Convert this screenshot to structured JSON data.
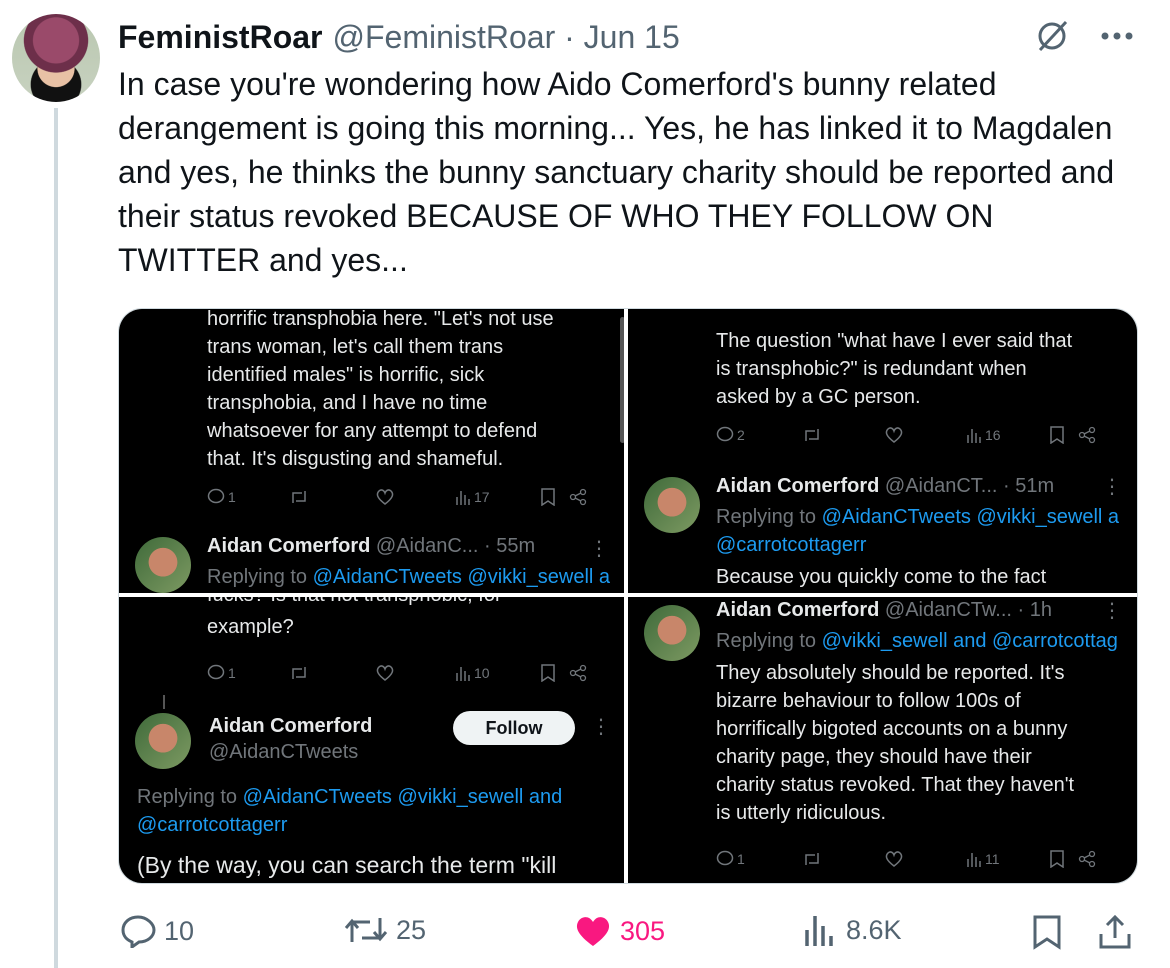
{
  "tweet": {
    "display_name": "FeministRoar",
    "handle_date": "@FeministRoar · Jun 15",
    "text": "In case you're wondering how Aido Comerford's bunny related derangement is going this morning... Yes, he has linked it to Magdalen and yes, he thinks the bunny sanctuary charity should be reported and their status revoked BECAUSE OF WHO THEY FOLLOW ON TWITTER and yes..."
  },
  "panels": {
    "p1": {
      "text": "horrific transphobia here. \"Let's not use\ntrans woman, let's call them trans\nidentified males\" is horrific, sick\ntransphobia, and I have no time\nwhatsoever for any attempt to defend\nthat. It's disgusting and shameful.",
      "replies": "1",
      "views": "17",
      "reply_name": "Aidan Comerford",
      "reply_handle": "@AidanC... · 55m",
      "replying_prefix": "Replying to ",
      "replying_links": "@AidanCTweets @vikki_sewell a"
    },
    "p2": {
      "text": "The question \"what have I ever said that\nis transphobic?\" is redundant when\nasked by a GC person.",
      "replies": "2",
      "views": "16",
      "reply_name": "Aidan Comerford",
      "reply_handle": "@AidanCT... · 51m",
      "replying_prefix": "Replying to ",
      "replying_links": "@AidanCTweets @vikki_sewell a",
      "replying_links2": "@carrotcottagerr",
      "reply_text": "Because you quickly come to the fact"
    },
    "p3": {
      "top_text": "fucks? Is that not transphobic, for",
      "text": "example?",
      "replies": "1",
      "views": "10",
      "name": "Aidan Comerford",
      "handle": "@AidanCTweets",
      "follow_label": "Follow",
      "replying_prefix": "Replying to ",
      "replying_links": "@AidanCTweets @vikki_sewell and",
      "replying_links2": "@carrotcottagerr",
      "body": "(By the way, you can search the term \"kill"
    },
    "p4": {
      "reply_name": "Aidan Comerford",
      "reply_handle": "@AidanCTw... · 1h",
      "replying_prefix": "Replying to ",
      "replying_links": "@vikki_sewell and @carrotcottag",
      "text": "They absolutely should be reported. It's\nbizarre behaviour to follow 100s of\nhorrifically bigoted accounts on a bunny\ncharity page, they should have their\ncharity status revoked. That they haven't\nis utterly ridiculous.",
      "replies": "1",
      "views": "11"
    }
  },
  "actions": {
    "replies": "10",
    "retweets": "25",
    "likes": "305",
    "views": "8.6K"
  },
  "colors": {
    "like": "#f91880",
    "link": "#1d9bf0",
    "muted": "#536471"
  }
}
